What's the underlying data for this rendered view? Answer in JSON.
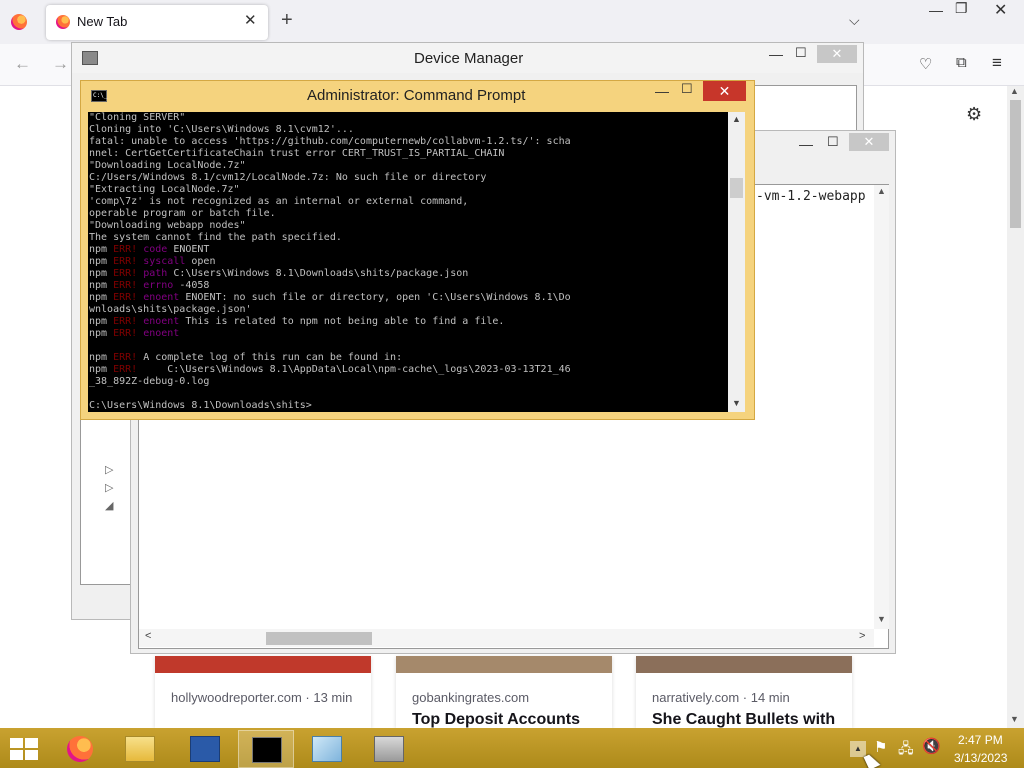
{
  "browser": {
    "tab_title": "New Tab",
    "tab_close": "✕",
    "new_tab": "+",
    "list_tabs": "⌵",
    "win_minimize": "—",
    "win_restore": "❐",
    "win_close": "✕",
    "back": "←",
    "forward": "→",
    "pocket": "♡",
    "extensions": "⧉",
    "menu": "≡",
    "settings": "⚙",
    "scroll_up": "▲",
    "scroll_down": "▼"
  },
  "cards": [
    {
      "source": "hollywoodreporter.com · 13 min",
      "title": "",
      "image_color": "#c0392b"
    },
    {
      "source": "gobankingrates.com",
      "title": "Top Deposit Accounts",
      "image_color": "#a5896b"
    },
    {
      "source": "narratively.com · 14 min",
      "title": "She Caught Bullets with",
      "image_color": "#8b6f5a"
    }
  ],
  "device_manager": {
    "title": "Device Manager",
    "minimize": "—",
    "maximize": "☐",
    "close": "✕",
    "tree_glyphs": [
      "▷",
      "▷",
      "◢"
    ]
  },
  "editor_window": {
    "visible_text": "-vm-1.2-webapp",
    "minimize": "—",
    "maximize": "☐",
    "close": "✕",
    "left_arrow": "<",
    "right_arrow": ">",
    "up_arrow": "▲",
    "down_arrow": "▼"
  },
  "cmd": {
    "title": "Administrator: Command Prompt",
    "icon_text": "C:\\_",
    "minimize": "—",
    "maximize": "☐",
    "close": "✕",
    "scroll_up": "▲",
    "scroll_down": "▼",
    "lines": [
      [
        {
          "t": "\"Cloning SERVER\"",
          "c": "n"
        }
      ],
      [
        {
          "t": "Cloning into 'C:\\Users\\Windows 8.1\\cvm12'...",
          "c": "n"
        }
      ],
      [
        {
          "t": "fatal: unable to access 'https://github.com/computernewb/collabvm-1.2.ts/': scha",
          "c": "n"
        }
      ],
      [
        {
          "t": "nnel: CertGetCertificateChain trust error CERT_TRUST_IS_PARTIAL_CHAIN",
          "c": "n"
        }
      ],
      [
        {
          "t": "\"Downloading LocalNode.7z\"",
          "c": "n"
        }
      ],
      [
        {
          "t": "C:/Users/Windows 8.1/cvm12/LocalNode.7z: No such file or directory",
          "c": "n"
        }
      ],
      [
        {
          "t": "\"Extracting LocalNode.7z\"",
          "c": "n"
        }
      ],
      [
        {
          "t": "'comp\\7z' is not recognized as an internal or external command,",
          "c": "n"
        }
      ],
      [
        {
          "t": "operable program or batch file.",
          "c": "n"
        }
      ],
      [
        {
          "t": "\"Downloading webapp nodes\"",
          "c": "n"
        }
      ],
      [
        {
          "t": "The system cannot find the path specified.",
          "c": "n"
        }
      ],
      [
        {
          "t": "npm ",
          "c": "n"
        },
        {
          "t": "ERR!",
          "c": "e"
        },
        {
          "t": " code",
          "c": "m"
        },
        {
          "t": " ENOENT",
          "c": "n"
        }
      ],
      [
        {
          "t": "npm ",
          "c": "n"
        },
        {
          "t": "ERR!",
          "c": "e"
        },
        {
          "t": " syscall",
          "c": "m"
        },
        {
          "t": " open",
          "c": "n"
        }
      ],
      [
        {
          "t": "npm ",
          "c": "n"
        },
        {
          "t": "ERR!",
          "c": "e"
        },
        {
          "t": " path",
          "c": "m"
        },
        {
          "t": " C:\\Users\\Windows 8.1\\Downloads\\shits/package.json",
          "c": "n"
        }
      ],
      [
        {
          "t": "npm ",
          "c": "n"
        },
        {
          "t": "ERR!",
          "c": "e"
        },
        {
          "t": " errno",
          "c": "m"
        },
        {
          "t": " -4058",
          "c": "n"
        }
      ],
      [
        {
          "t": "npm ",
          "c": "n"
        },
        {
          "t": "ERR!",
          "c": "e"
        },
        {
          "t": " enoent",
          "c": "m"
        },
        {
          "t": " ENOENT: no such file or directory, open 'C:\\Users\\Windows 8.1\\Do",
          "c": "n"
        }
      ],
      [
        {
          "t": "wnloads\\shits\\package.json'",
          "c": "n"
        }
      ],
      [
        {
          "t": "npm ",
          "c": "n"
        },
        {
          "t": "ERR!",
          "c": "e"
        },
        {
          "t": " enoent",
          "c": "m"
        },
        {
          "t": " This is related to npm not being able to find a file.",
          "c": "n"
        }
      ],
      [
        {
          "t": "npm ",
          "c": "n"
        },
        {
          "t": "ERR!",
          "c": "e"
        },
        {
          "t": " enoent",
          "c": "m"
        }
      ],
      [
        {
          "t": "",
          "c": "n"
        }
      ],
      [
        {
          "t": "npm ",
          "c": "n"
        },
        {
          "t": "ERR!",
          "c": "e"
        },
        {
          "t": " A complete log of this run can be found in:",
          "c": "n"
        }
      ],
      [
        {
          "t": "npm ",
          "c": "n"
        },
        {
          "t": "ERR!",
          "c": "e"
        },
        {
          "t": "     C:\\Users\\Windows 8.1\\AppData\\Local\\npm-cache\\_logs\\2023-03-13T21_46",
          "c": "n"
        }
      ],
      [
        {
          "t": "_38_892Z-debug-0.log",
          "c": "n"
        }
      ],
      [
        {
          "t": "",
          "c": "n"
        }
      ],
      [
        {
          "t": "C:\\Users\\Windows 8.1\\Downloads\\shits>",
          "c": "n"
        }
      ]
    ]
  },
  "taskbar": {
    "items": [
      {
        "name": "firefox-taskbar-button",
        "icon": "firefox-icon",
        "active": false
      },
      {
        "name": "file-explorer-taskbar-button",
        "icon": "folder-icon",
        "active": false
      },
      {
        "name": "powershell-taskbar-button",
        "icon": "powershell-icon",
        "active": false
      },
      {
        "name": "cmd-taskbar-button",
        "icon": "cmd-icon",
        "active": true
      },
      {
        "name": "notepad-taskbar-button",
        "icon": "notepad-icon",
        "active": false
      },
      {
        "name": "device-manager-taskbar-button",
        "icon": "device-manager-icon",
        "active": false
      }
    ],
    "tray_up": "▲",
    "flag": "⚑",
    "network": "🖧",
    "volume": "🔇",
    "time": "2:47 PM",
    "date": "3/13/2023"
  },
  "colors": {
    "taskbar": "#b8941f",
    "cmd_frame": "#f5d37e",
    "cmd_close": "#c7362a",
    "npm_err": "#800000",
    "npm_key": "#800080"
  }
}
